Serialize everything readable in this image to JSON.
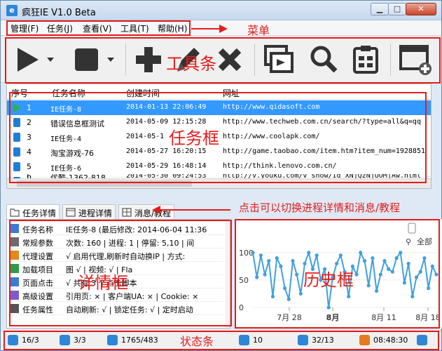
{
  "window": {
    "title": "疯狂IE V1.0 Beta",
    "icon": "app-e-icon"
  },
  "menu": [
    "管理(F)",
    "任务(J)",
    "查看(V)",
    "工具(T)",
    "帮助(H)"
  ],
  "toolbar": {
    "icons": [
      "play-icon",
      "stop-icon",
      "add-icon",
      "edit-icon",
      "delete-icon",
      "copy-window-icon",
      "search-icon",
      "clipboard-icon",
      "new-window-icon"
    ]
  },
  "grid": {
    "columns": [
      "序号",
      "任务名称",
      "创建时间",
      "网址"
    ],
    "rows": [
      {
        "no": "1",
        "name": "IE任务-8",
        "time": "2014-01-13 22:06:49",
        "url": "http://www.qidasoft.com",
        "state": "running"
      },
      {
        "no": "2",
        "name": "错误信息框测试",
        "time": "2014-05-09 12:15:28",
        "url": "http://www.techweb.com.cn/search/?type=all&q=qq",
        "state": "idle"
      },
      {
        "no": "3",
        "name": "IE任务-4",
        "time": "2014-05-1",
        "url": "http://www.coolapk.com/",
        "state": "idle"
      },
      {
        "no": "4",
        "name": "淘宝游戏-76",
        "time": "2014-05-27 16:20:15",
        "url": "http://game.taobao.com/item.htm?item_num=1928851",
        "state": "idle"
      },
      {
        "no": "5",
        "name": "IE任务-6",
        "time": "2014-05-29 16:48:14",
        "url": "http://think.lenovo.com.cn/",
        "state": "idle"
      },
      {
        "no": "6",
        "name": "优酷-1362-818",
        "time": "2014-05-30 09:24:53",
        "url": "http://v.youku.com/v_show/id_XNjQzNjUOMjAw.html",
        "state": "idle"
      }
    ]
  },
  "tabs": [
    "任务详情",
    "进程详情",
    "消息/教程"
  ],
  "details": [
    {
      "label": "任务名称",
      "value": "IE任务-8 (最后修改: 2014-06-04 11:36"
    },
    {
      "label": "常规参数",
      "value": "次数: 160 | 进程: 1 | 停留: 5,10 | 间"
    },
    {
      "label": "代理设置",
      "value": "√ 启用代理,刷新时自动换IP | 方式:"
    },
    {
      "label": "加载项目",
      "value": "图  √ | 视频: √ | Fla"
    },
    {
      "label": "页面点击",
      "value": "√  共有 3 个点击脚本"
    },
    {
      "label": "高级设置",
      "value": "引用页: × | 客户端UA: × | Cookie: ×"
    },
    {
      "label": "任务属性",
      "value": "自动刷新: √ | 锁定任务: √ | 定时启动"
    }
  ],
  "chart_data": {
    "type": "line",
    "y_ticks": [
      "100",
      "50",
      "0"
    ],
    "x_ticks": [
      "7月 28",
      "8月",
      "8月 11",
      "8月 18"
    ],
    "values": [
      100,
      55,
      95,
      60,
      85,
      20,
      90,
      75,
      35,
      15,
      85,
      60,
      25,
      80,
      100,
      70,
      95,
      50,
      70,
      0,
      55,
      80,
      95,
      65,
      20,
      75,
      60,
      100,
      85,
      40,
      90,
      30,
      60,
      85,
      70,
      65,
      90,
      100,
      45,
      80,
      20,
      55,
      65,
      90,
      35,
      75,
      60
    ],
    "ylim": [
      0,
      110
    ],
    "color": "#3fa0de",
    "zoom_label": "全部"
  },
  "status": [
    {
      "icon": "monitor-icon",
      "text": "16/3",
      "color": "#2f86d6"
    },
    {
      "icon": "window-icon",
      "text": "3/3",
      "color": "#2f86d6"
    },
    {
      "icon": "users-icon",
      "text": "1765/483",
      "color": "#2f86d6"
    },
    {
      "icon": "check-icon",
      "text": "10",
      "color": "#2f86d6"
    },
    {
      "icon": "refresh-icon",
      "text": "32/13",
      "color": "#2f86d6"
    },
    {
      "icon": "clock-icon",
      "text": "08:48:30",
      "color": "#e87a1e"
    },
    {
      "icon": "chat-icon",
      "text": "",
      "color": "#2f86d6"
    }
  ],
  "annotations": {
    "menu": "菜单",
    "toolbar": "工具条",
    "grid": "任务框",
    "tabs": "点击可以切换进程详情和消息/教程",
    "details": "详情框",
    "history": "历史框",
    "status": "状态条"
  }
}
